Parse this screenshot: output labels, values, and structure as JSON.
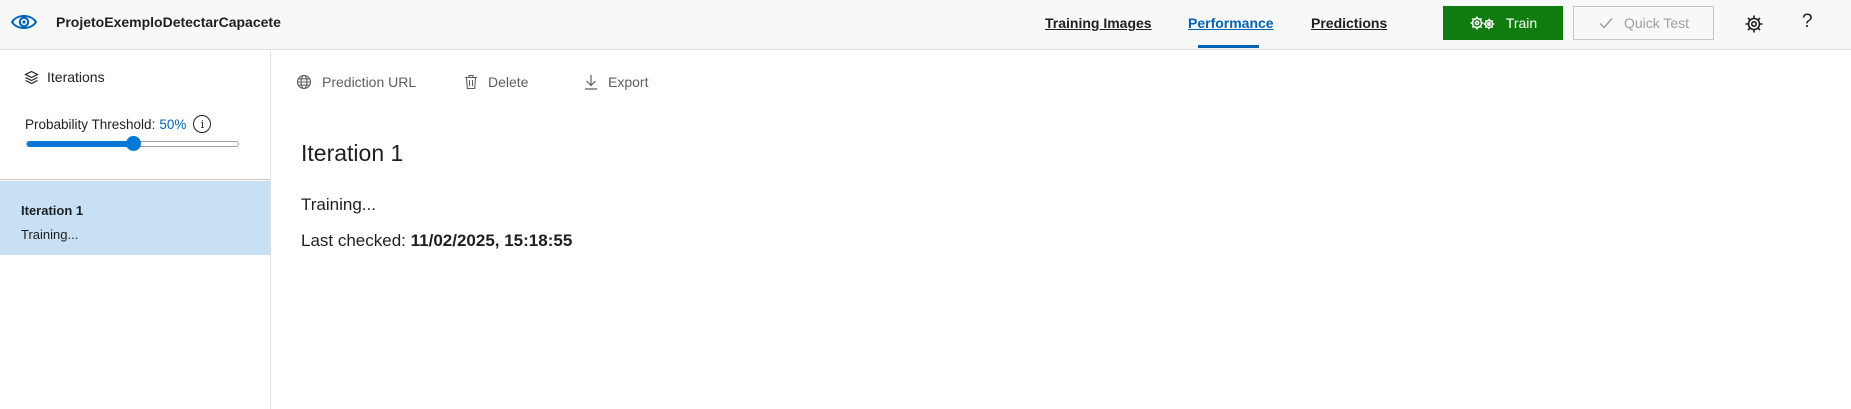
{
  "header": {
    "project_name": "ProjetoExemploDetectarCapacete",
    "nav": [
      {
        "label": "Training Images",
        "active": false
      },
      {
        "label": "Performance",
        "active": true
      },
      {
        "label": "Predictions",
        "active": false
      }
    ],
    "train_label": "Train",
    "quick_test_label": "Quick Test",
    "help_label": "?"
  },
  "sidebar": {
    "iterations_label": "Iterations",
    "threshold_label": "Probability Threshold:",
    "threshold_value": "50%",
    "threshold_percent": 50,
    "info_glyph": "i",
    "items": [
      {
        "name": "Iteration 1",
        "status": "Training...",
        "selected": true
      }
    ]
  },
  "toolbar": {
    "prediction_url_label": "Prediction URL",
    "delete_label": "Delete",
    "export_label": "Export"
  },
  "main": {
    "title": "Iteration 1",
    "status": "Training...",
    "last_checked_label": "Last checked:",
    "last_checked_value": "11/02/2025, 15:18:55"
  },
  "colors": {
    "accent": "#0064b4",
    "train_button": "#107c10",
    "selected_item": "#c7e0f4",
    "slider": "#0078d4"
  },
  "icons": {
    "project": "eye-icon",
    "train": "gears-icon",
    "quick_test": "checkmark-icon",
    "settings": "gear-icon",
    "iterations": "layers-icon",
    "prediction_url": "globe-icon",
    "delete": "trash-icon",
    "export": "download-icon"
  }
}
